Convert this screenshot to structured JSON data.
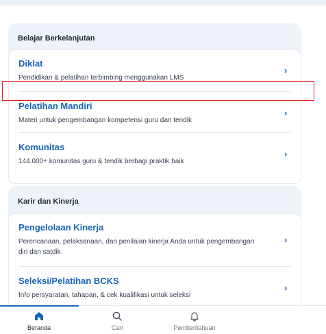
{
  "sections": [
    {
      "title": "Belajar Berkelanjutan",
      "items": [
        {
          "title": "Diklat",
          "desc": "Pendidikan & pelatihan terbimbing menggunakan LMS"
        },
        {
          "title": "Pelatihan Mandiri",
          "desc": "Materi untuk pengembangan kompetensi guru dan tendik"
        },
        {
          "title": "Komunitas",
          "desc": "144.000+ komunitas guru & tendik berbagi praktik baik"
        }
      ]
    },
    {
      "title": "Karir dan Kinerja",
      "items": [
        {
          "title": "Pengelolaan Kinerja",
          "desc_line1": "Perencanaan, pelaksanaan, dan penilaian kinerja Anda untuk pengembangan",
          "desc_line2": "diri dan satdik"
        },
        {
          "title": "Seleksi/Pelatihan BCKS",
          "desc": "Info persyaratan, tahapan, & cek kualifikasi untuk seleksi"
        }
      ]
    }
  ],
  "chevron_glyph": "›",
  "bottom_nav": {
    "items": [
      {
        "label": "Beranda",
        "icon": "home-icon",
        "active": true
      },
      {
        "label": "Cari",
        "icon": "search-icon",
        "active": false
      },
      {
        "label": "Pemberitahuan",
        "icon": "bell-icon",
        "active": false
      }
    ]
  },
  "colors": {
    "accent": "#1764b4",
    "section_bg": "#eef3fa",
    "highlight": "#e11d1d"
  }
}
